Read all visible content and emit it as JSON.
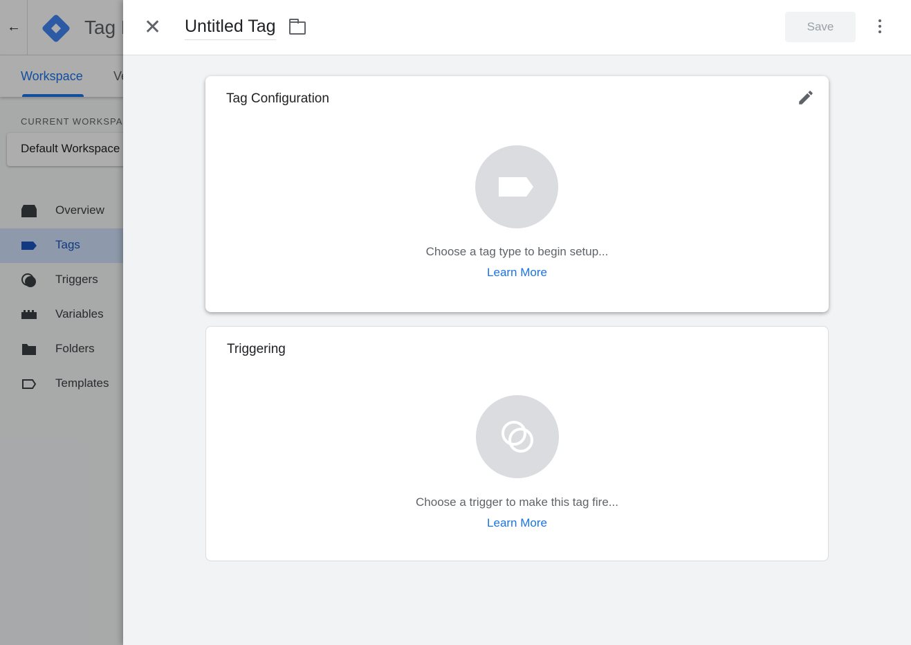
{
  "app": {
    "title": "Tag Manager",
    "back_icon": "arrow-left-icon"
  },
  "tabs": [
    {
      "label": "Workspace",
      "active": true
    },
    {
      "label": "Versions"
    }
  ],
  "workspace": {
    "label": "CURRENT WORKSPACE",
    "name": "Default Workspace"
  },
  "nav": [
    {
      "label": "Overview",
      "icon": "overview-icon"
    },
    {
      "label": "Tags",
      "icon": "tag-icon",
      "active": true
    },
    {
      "label": "Triggers",
      "icon": "trigger-icon"
    },
    {
      "label": "Variables",
      "icon": "variables-icon"
    },
    {
      "label": "Folders",
      "icon": "folder-icon"
    },
    {
      "label": "Templates",
      "icon": "template-icon"
    }
  ],
  "panel": {
    "tag_name": "Untitled Tag",
    "save_label": "Save",
    "tag_config": {
      "title": "Tag Configuration",
      "hint": "Choose a tag type to begin setup...",
      "link": "Learn More"
    },
    "triggering": {
      "title": "Triggering",
      "hint": "Choose a trigger to make this tag fire...",
      "link": "Learn More"
    }
  },
  "colors": {
    "accent": "#1a73e8",
    "placeholder_circle": "#dadce0"
  }
}
